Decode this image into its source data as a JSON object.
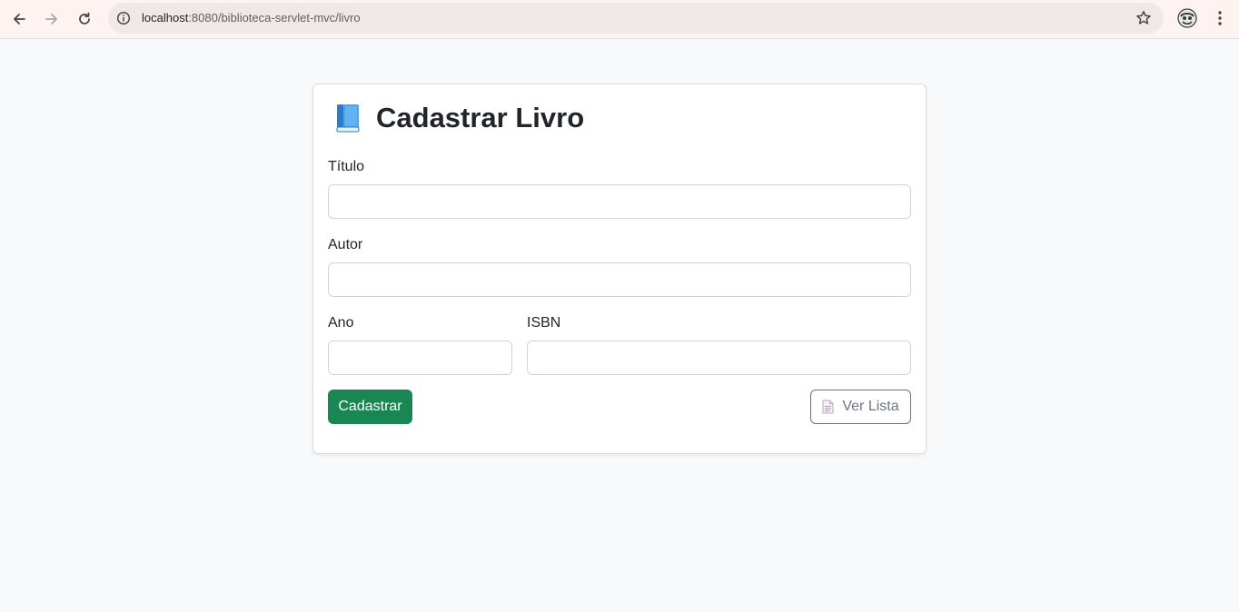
{
  "browser": {
    "url_host": "localhost",
    "url_rest": ":8080/biblioteca-servlet-mvc/livro",
    "icons": [
      "back-icon",
      "forward-icon",
      "reload-icon",
      "info-icon",
      "star-icon",
      "profile-icon",
      "more-icon"
    ]
  },
  "form": {
    "title": "Cadastrar Livro",
    "title_icon": "book-icon",
    "fields": {
      "titulo": {
        "label": "Título",
        "value": ""
      },
      "autor": {
        "label": "Autor",
        "value": ""
      },
      "ano": {
        "label": "Ano",
        "value": ""
      },
      "isbn": {
        "label": "ISBN",
        "value": ""
      }
    },
    "submit_label": "Cadastrar",
    "list_label": "Ver Lista",
    "list_icon": "document-icon"
  },
  "colors": {
    "page_bg": "#f8f9fa",
    "submit_bg": "#198754",
    "list_border": "#6c757d",
    "chrome_bg": "#fdf4f2"
  }
}
